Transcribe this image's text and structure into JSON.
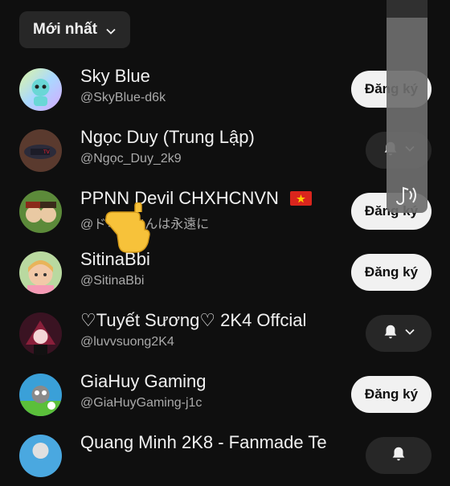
{
  "sort": {
    "label": "Mới nhất",
    "icon": "chevron-down-icon"
  },
  "channels": [
    {
      "name": "Sky Blue",
      "handle": "@SkyBlue-d6k",
      "action": "subscribe",
      "action_label": "Đăng ký"
    },
    {
      "name": "Ngọc Duy (Trung Lập)",
      "handle": "@Ngọc_Duy_2k9",
      "action": "bell"
    },
    {
      "name": "PPNN Devil CHXHCNVN",
      "name_flag": "🇻🇳",
      "handle": "@ドミノさんは永遠に",
      "action": "subscribe",
      "action_label": "Đăng ký"
    },
    {
      "name": "SitinaBbi",
      "handle": "@SitinaBbi",
      "action": "subscribe",
      "action_label": "Đăng ký"
    },
    {
      "name": "♡Tuyết Sương♡ 2K4 Offcial",
      "handle": "@luvvsuong2K4",
      "action": "bell"
    },
    {
      "name": "GiaHuy Gaming",
      "handle": "@GiaHuyGaming-j1c",
      "action": "subscribe",
      "action_label": "Đăng ký"
    },
    {
      "name": "Quang Minh 2K8 - Fanmade Te",
      "handle": "",
      "action": "bell"
    }
  ],
  "colors": {
    "background": "#0f0f0f",
    "chip": "#272727",
    "subscribe_bg": "#f1f1f1",
    "secondary_text": "#aaaaaa"
  }
}
